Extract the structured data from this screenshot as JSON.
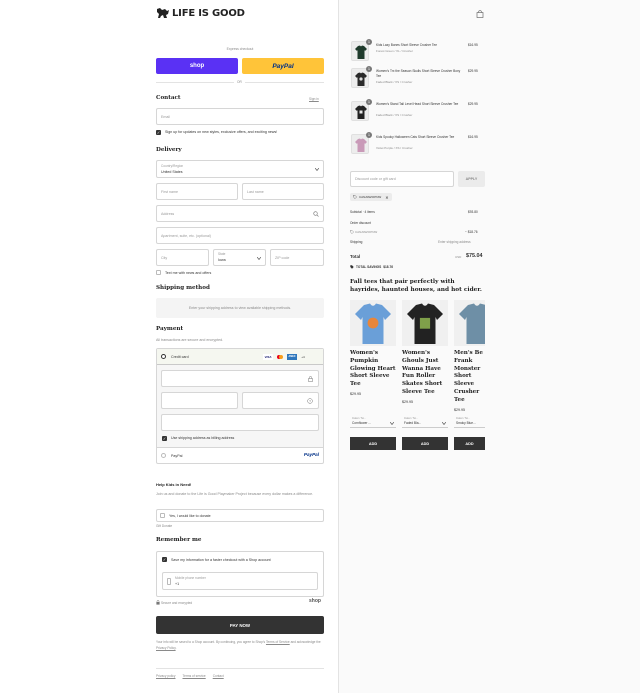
{
  "brand": {
    "logo_text": "LIFE IS GOOD",
    "logo_icon": "jake-dog-icon",
    "cart_icon": "shopping-bag-icon"
  },
  "express": {
    "label": "Express checkout",
    "shop_label": "shop",
    "paypal_label": "PayPal",
    "or_label": "OR"
  },
  "contact": {
    "title": "Contact",
    "signin_label": "Sign in",
    "email_placeholder": "Email",
    "news_label": "Sign up for updates on new styles, exclusive offers, and exciting news!"
  },
  "delivery": {
    "title": "Delivery",
    "country_label": "Country/Region",
    "country_value": "United States",
    "first_name": "First name",
    "last_name": "Last name",
    "address": "Address",
    "apartment": "Apartment, suite, etc. (optional)",
    "city": "City",
    "state_label": "State",
    "state_value": "Iowa",
    "zip": "ZIP code",
    "text_me_label": "Text me with news and offers"
  },
  "shipping_method": {
    "title": "Shipping method",
    "note": "Enter your shipping address to view available shipping methods."
  },
  "payment": {
    "title": "Payment",
    "subtitle": "All transactions are secure and encrypted.",
    "credit_card_label": "Credit card",
    "card_brands": [
      "VISA",
      "MC",
      "AMEX",
      "+4"
    ],
    "billing_label": "Use shipping address as billing address",
    "paypal_option": "PayPal",
    "paypal_logo": "PayPal"
  },
  "donate": {
    "title": "Help Kids in Need!",
    "text": "Join us and donate to the Life is Good Playmaker Project because every dollar makes a difference.",
    "option_label": "Yes, I would like to donate",
    "powered": "Gift Donate"
  },
  "remember": {
    "title": "Remember me",
    "save_label": "Save my information for a faster checkout with a Shop account",
    "phone_label": "Mobile phone number",
    "phone_value": "+1",
    "secure_label": "Secure and encrypted",
    "shop_logo": "shop"
  },
  "pay_now": "PAY NOW",
  "legal": {
    "text": "Your info will be saved to a Shop account. By continuing, you agree to Shop's",
    "terms": "Terms of Service",
    "middle": "and acknowledge the",
    "privacy": "Privacy Policy",
    "end": "."
  },
  "footer_links": [
    "Privacy policy",
    "Terms of service",
    "Contact"
  ],
  "cart": {
    "items": [
      {
        "qty": "1",
        "name": "Kids Lazy Bones Short Sleeve Crusher Tee",
        "variant": "Forest Green / XL / Crusher",
        "price": "$16.95",
        "color": "#1f3b2c"
      },
      {
        "qty": "1",
        "name": "Women's Trx the Season Skulls Short Sleeve Crusher Boxy Tee",
        "variant": "Faded Black / XS / Crusher",
        "price": "$29.95",
        "color": "#2a2a2a"
      },
      {
        "qty": "1",
        "name": "Women's Stand Tall Level Head Short Sleeve Crusher Tee",
        "variant": "Faded Black / XS / Crusher",
        "price": "$29.95",
        "color": "#222222"
      },
      {
        "qty": "1",
        "name": "Kids Spooky Halloween Cats Short Sleeve Crusher Tee",
        "variant": "Violet Purple / XS / Crusher",
        "price": "$16.95",
        "color": "#c99ab8"
      }
    ],
    "discount_placeholder": "Discount code or gift card",
    "apply_label": "APPLY",
    "applied_code": "CANAWZOPNW",
    "subtotal_label": "Subtotal · 4 items",
    "subtotal_value": "$93.80",
    "order_discount_label": "Order discount",
    "order_discount_code": "CANAWZOPNW",
    "order_discount_value": "− $18.76",
    "shipping_label": "Shipping",
    "shipping_value": "Enter shipping address",
    "total_label": "Total",
    "total_currency": "USD",
    "total_value": "$75.04",
    "savings_label": "TOTAL SAVINGS",
    "savings_value": "$18.76"
  },
  "recommend": {
    "heading": "Fall tees that pair perfectly with hayrides, haunted houses, and hot cider.",
    "cards": [
      {
        "title": "Women's Pumpkin Glowing Heart Short Sleeve Tee",
        "price": "$29.95",
        "option": "Cornflower ...",
        "opt_label": "Color / Si...",
        "add": "ADD",
        "shirt": "#6a9fd8"
      },
      {
        "title": "Women's Ghouls Just Wanna Have Fun Roller Skates Short Sleeve Tee",
        "price": "$29.95",
        "option": "Faded Bla...",
        "opt_label": "Color / Si...",
        "add": "ADD",
        "shirt": "#222222"
      },
      {
        "title": "Men's Be Frank Monster Short Sleeve Crusher Tee",
        "price": "$29.95",
        "option": "Smoky Blue...",
        "opt_label": "Color / Si...",
        "add": "ADD",
        "shirt": "#6e8fa6"
      }
    ]
  }
}
